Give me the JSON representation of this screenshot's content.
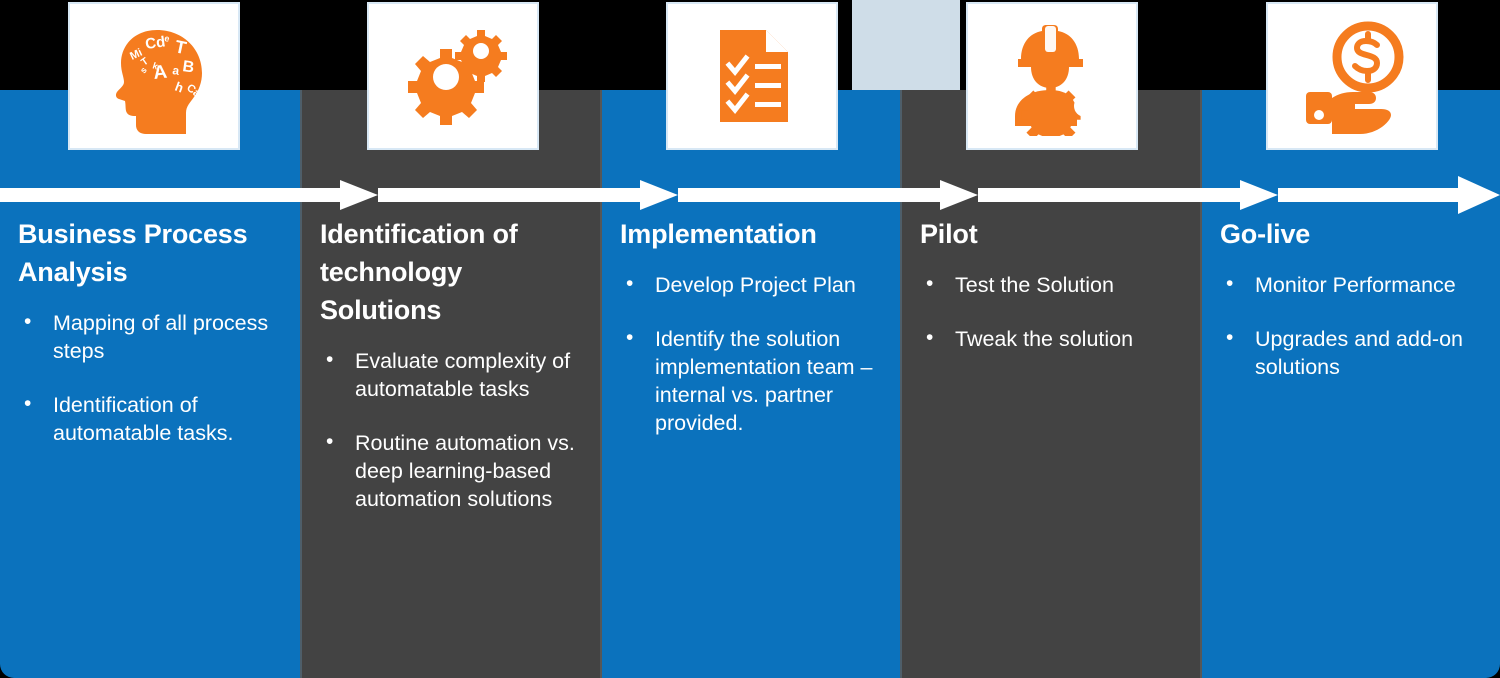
{
  "theme": {
    "blue": "#0b72bd",
    "dark": "#434343",
    "orange": "#f57c1f",
    "white": "#ffffff",
    "gap_panel": "#cfdde8"
  },
  "arrow_band": {
    "name": "process-flow-arrow",
    "description": "white horizontal arrow running left to right across all phases"
  },
  "phases": [
    {
      "id": "business-process-analysis",
      "title": "Business Process Analysis",
      "color": "blue",
      "icon": "head-with-letters-icon",
      "bullets": [
        "Mapping of all process steps",
        "Identification of automatable tasks."
      ]
    },
    {
      "id": "identification-of-technology-solutions",
      "title": "Identification of technology Solutions",
      "color": "dark",
      "icon": "gears-icon",
      "bullets": [
        "Evaluate complexity of automatable tasks",
        "Routine automation vs. deep learning-based automation solutions"
      ]
    },
    {
      "id": "implementation",
      "title": "Implementation",
      "color": "blue",
      "icon": "checklist-document-icon",
      "bullets": [
        "Develop Project Plan",
        "Identify the solution implementation team – internal vs. partner provided."
      ]
    },
    {
      "id": "pilot",
      "title": "Pilot",
      "color": "dark",
      "icon": "worker-with-gear-icon",
      "bullets": [
        "Test the Solution",
        "Tweak the solution"
      ]
    },
    {
      "id": "go-live",
      "title": "Go-live",
      "color": "blue",
      "icon": "hand-with-dollar-coin-icon",
      "bullets": [
        "Monitor Performance",
        "Upgrades and add-on solutions"
      ]
    }
  ]
}
